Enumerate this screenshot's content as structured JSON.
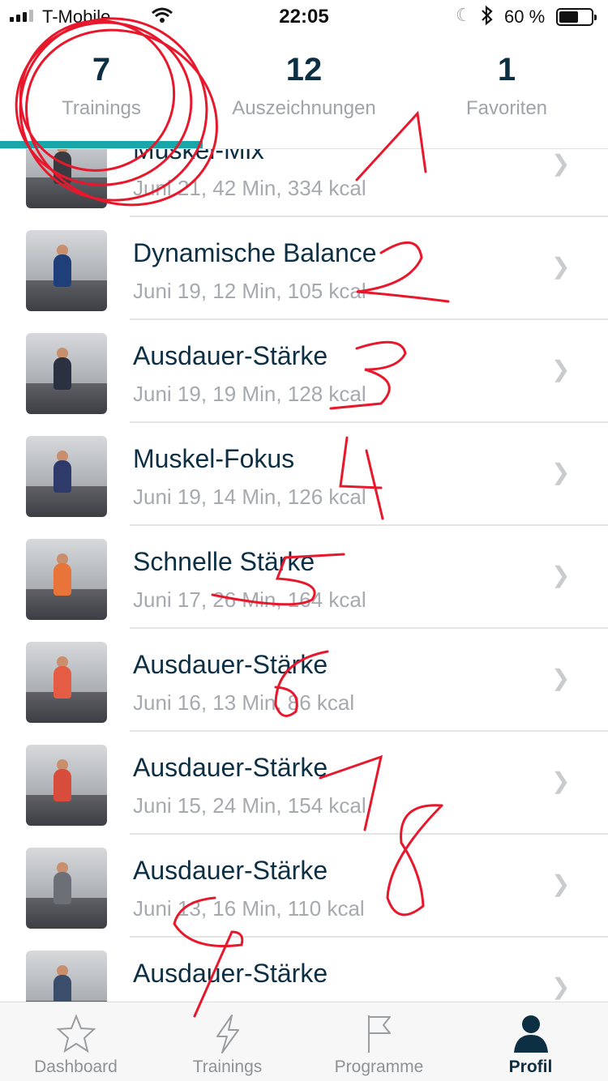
{
  "status": {
    "carrier": "T-Mobile",
    "time": "22:05",
    "battery": "60 %",
    "battery_level": 0.6
  },
  "stats": [
    {
      "number": "7",
      "label": "Trainings"
    },
    {
      "number": "12",
      "label": "Auszeichnungen"
    },
    {
      "number": "1",
      "label": "Favoriten"
    }
  ],
  "workouts": [
    {
      "title": "Muskel-Mix",
      "sub": "Juni 21, 42 Min, 334 kcal",
      "thumb_color": "#3a3b41"
    },
    {
      "title": "Dynamische Balance",
      "sub": "Juni 19, 12 Min, 105 kcal",
      "thumb_color": "#1f3f7a"
    },
    {
      "title": "Ausdauer-Stärke",
      "sub": "Juni 19, 19 Min, 128 kcal",
      "thumb_color": "#2b3140"
    },
    {
      "title": "Muskel-Fokus",
      "sub": "Juni 19, 14 Min, 126 kcal",
      "thumb_color": "#2d3a6a"
    },
    {
      "title": "Schnelle Stärke",
      "sub": "Juni 17, 26 Min, 164 kcal",
      "thumb_color": "#e8743a"
    },
    {
      "title": "Ausdauer-Stärke",
      "sub": "Juni 16, 13 Min, 86 kcal",
      "thumb_color": "#e35c43"
    },
    {
      "title": "Ausdauer-Stärke",
      "sub": "Juni 15, 24 Min, 154 kcal",
      "thumb_color": "#d84c3c"
    },
    {
      "title": "Ausdauer-Stärke",
      "sub": "Juni 13, 16 Min, 110 kcal",
      "thumb_color": "#6c6f76"
    },
    {
      "title": "Ausdauer-Stärke",
      "sub": "",
      "thumb_color": "#3a4d6a"
    }
  ],
  "tabs": [
    {
      "label": "Dashboard",
      "icon": "star-icon"
    },
    {
      "label": "Trainings",
      "icon": "lightning-icon"
    },
    {
      "label": "Programme",
      "icon": "flag-icon"
    },
    {
      "label": "Profil",
      "icon": "person-icon"
    }
  ],
  "active_tab": "Profil",
  "colors": {
    "accent": "#19a6a8",
    "text_dark": "#0d2f44",
    "text_muted": "#a6a9ad",
    "annotation": "#e8182c"
  },
  "annotations": [
    "1",
    "2",
    "3",
    "4",
    "5",
    "6",
    "7",
    "8",
    "9"
  ]
}
